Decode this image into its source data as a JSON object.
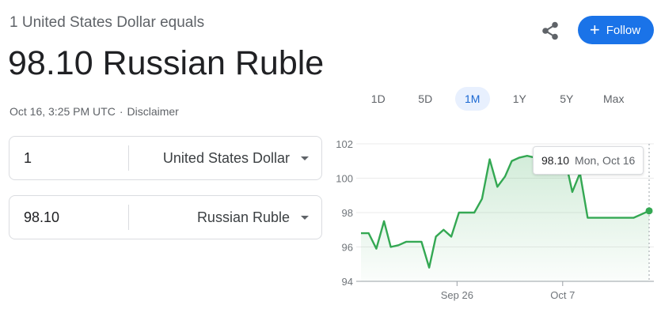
{
  "header": {
    "subtitle": "1 United States Dollar equals",
    "main_value": "98.10 Russian Ruble",
    "timestamp": "Oct 16, 3:25 PM UTC",
    "separator": "·",
    "disclaimer": "Disclaimer",
    "follow_label": "Follow",
    "share_icon": "share-icon",
    "accent": "#1a73e8"
  },
  "converter": {
    "from": {
      "amount": "1",
      "currency": "United States Dollar"
    },
    "to": {
      "amount": "98.10",
      "currency": "Russian Ruble"
    }
  },
  "range_tabs": {
    "items": [
      "1D",
      "5D",
      "1M",
      "1Y",
      "5Y",
      "Max"
    ],
    "selected": "1M"
  },
  "tooltip": {
    "value": "98.10",
    "date": "Mon, Oct 16"
  },
  "chart_data": {
    "type": "area",
    "title": "",
    "xlabel": "",
    "ylabel": "",
    "ylim": [
      94,
      102
    ],
    "y_ticks": [
      94,
      96,
      98,
      100,
      102
    ],
    "x_tick_labels": [
      {
        "label": "Sep 26",
        "x": 10
      },
      {
        "label": "Oct 7",
        "x": 21
      }
    ],
    "x_range": [
      0,
      30
    ],
    "line_color": "#34a853",
    "grid": true,
    "series": [
      {
        "x": [
          0,
          0.8,
          1.6,
          2.4,
          3.1,
          3.9,
          4.7,
          5.5,
          6.3,
          7.1,
          7.8,
          8.6,
          9.4,
          10.2,
          11.0,
          11.8,
          12.6,
          13.4,
          14.2,
          15.0,
          15.7,
          16.5,
          17.3,
          18.1,
          18.9,
          19.7,
          20.5,
          21.3,
          22.0,
          22.8,
          23.6,
          24.4,
          25.2,
          26.0,
          26.8,
          27.6,
          28.4,
          29.2,
          30
        ],
        "y": [
          96.8,
          96.8,
          95.9,
          97.5,
          96.0,
          96.1,
          96.3,
          96.3,
          96.3,
          94.8,
          96.6,
          97.0,
          96.6,
          98.0,
          98.0,
          98.0,
          98.8,
          101.1,
          99.5,
          100.1,
          101.0,
          101.2,
          101.3,
          101.2,
          101.1,
          101.0,
          100.8,
          101.0,
          99.2,
          100.3,
          97.7,
          97.7,
          97.7,
          97.7,
          97.7,
          97.7,
          97.7,
          97.9,
          98.1
        ]
      }
    ]
  }
}
